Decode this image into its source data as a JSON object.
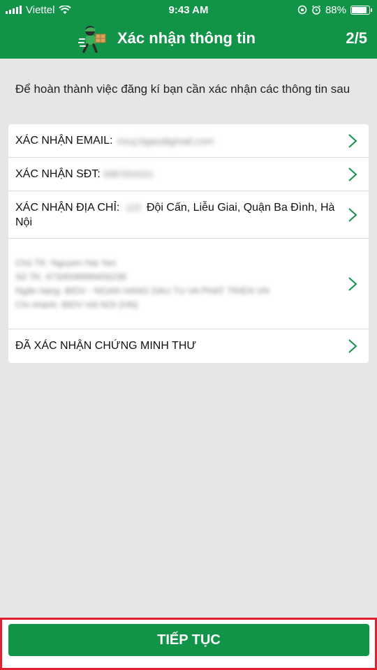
{
  "status_bar": {
    "carrier": "Viettel",
    "time": "9:43 AM",
    "battery": "88%",
    "battery_level": 0.88
  },
  "header": {
    "title": "Xác nhận thông tin",
    "step": "2/5"
  },
  "intro_text": "Để hoàn thành việc đăng kí bạn cần xác nhận các thông tin sau",
  "rows": {
    "email": {
      "label": "XÁC NHẬN EMAIL:",
      "value": "nvuy.bgaudigmail.com"
    },
    "phone": {
      "label": "XÁC NHẬN SĐT:",
      "value": "0987654321"
    },
    "address": {
      "label": "XÁC NHẬN ĐỊA CHỈ:",
      "value_hidden": "123",
      "value": "Đội Cấn, Liễu Giai, Quận Ba Đình, Hà Nội"
    },
    "bank": {
      "lines": [
        "Chủ TK: Nguyen Hai Yen",
        "Số TK: 4733508999456238",
        "Ngân hàng: BIDV - NGAN HANG DAU TU VA PHAT TRIEN VN",
        "Chi nhánh: BIDV HA NOI (HN)"
      ]
    },
    "id_card": {
      "label": "ĐÃ XÁC NHẬN CHỨNG MINH THƯ"
    }
  },
  "footer": {
    "continue_label": "TIẾP TỤC"
  },
  "colors": {
    "brand_green": "#119447",
    "highlight_red": "#e0202e"
  }
}
